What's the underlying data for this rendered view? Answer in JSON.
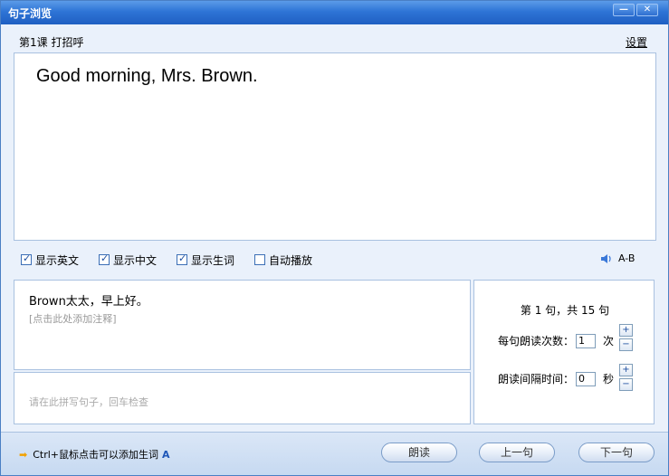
{
  "window": {
    "title": "句子浏览",
    "min_label": "—",
    "close_label": "✕"
  },
  "header": {
    "lesson": "第1课 打招呼",
    "settings_label": "设置"
  },
  "sentence": {
    "english": "Good morning, Mrs. Brown.",
    "chinese": "Brown太太，早上好。",
    "note_hint": "[点击此处添加注释]"
  },
  "options": {
    "show_english": {
      "label": "显示英文",
      "checked": true
    },
    "show_chinese": {
      "label": "显示中文",
      "checked": true
    },
    "show_words": {
      "label": "显示生词",
      "checked": true
    },
    "auto_play": {
      "label": "自动播放",
      "checked": false
    },
    "ab_label": "A-B"
  },
  "dictation": {
    "placeholder": "请在此拼写句子，回车检查"
  },
  "side": {
    "counter": "第 1 句，共 15 句",
    "repeat_label": "每句朗读次数：",
    "repeat_value": "1",
    "repeat_unit": "次",
    "interval_label": "朗读间隔时间：",
    "interval_value": "0",
    "interval_unit": "秒",
    "plus": "+",
    "minus": "−"
  },
  "footer": {
    "tip": "Ctrl+鼠标点击可以添加生词",
    "tip_icon": "A",
    "read_label": "朗读",
    "prev_label": "上一句",
    "next_label": "下一句"
  },
  "colors": {
    "titlebar": "#2e74d6",
    "accent": "#1e4fa0",
    "panel_bg": "#eaf1fb"
  }
}
